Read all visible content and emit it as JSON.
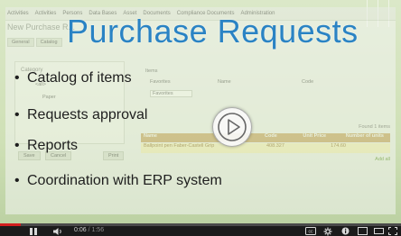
{
  "app": {
    "menu": [
      "Activities",
      "Activities",
      "Persons",
      "Data Bases",
      "Asset",
      "Documents",
      "Compliance Documents",
      "Administration"
    ],
    "title": "New Purchase R...",
    "tabs": [
      "General",
      "Catalog"
    ],
    "category_label": "Category",
    "tree_item": "<all>",
    "tree_sub": "Paper",
    "items_label": "Items",
    "favorites_label": "Favorites",
    "favorites_value": "Favorites",
    "name_label": "Name",
    "code_label": "Code",
    "found": "Found 1 items",
    "table_headers": [
      "Name",
      "Code",
      "Unit Price",
      "Number of units"
    ],
    "table_row": [
      "Ballpoint pen Faber-Castell Grip",
      "408.327",
      "174.60",
      ""
    ],
    "add_all": "Add all",
    "buttons": [
      "Save",
      "Cancel",
      "Print"
    ]
  },
  "slide": {
    "title": "Purchase Requests",
    "bullets": [
      "Catalog of items",
      "Requests approval",
      "Reports",
      "Coordination with ERP system"
    ]
  },
  "player": {
    "current_time": "0:06",
    "duration": "/ 1:56",
    "progress": 0.052,
    "accent": "#d21e1e"
  },
  "colors": {
    "title": "#2a83c4",
    "background": "#cfe0b6"
  }
}
